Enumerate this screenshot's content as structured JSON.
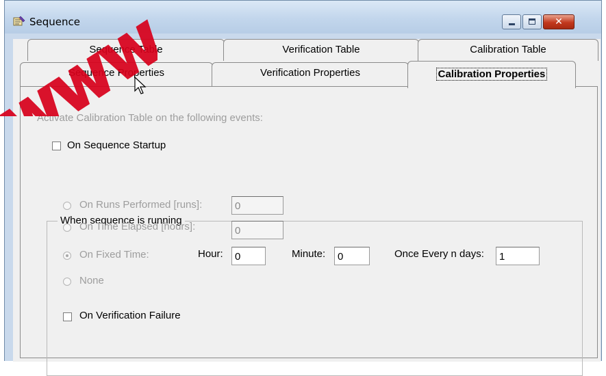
{
  "window": {
    "title": "Sequence",
    "controls": {
      "minimize": "minimize-icon",
      "maximize": "maximize-icon",
      "close": "✕"
    }
  },
  "tabs": {
    "row_back": [
      "Sequence Table",
      "Verification Table",
      "Calibration Table"
    ],
    "row_front": [
      "Sequence Properties",
      "Verification Properties",
      "Calibration Properties"
    ],
    "active": "Calibration Properties"
  },
  "panel": {
    "heading": "Activate Calibration Table on the following events:",
    "on_sequence_startup": {
      "label": "On Sequence Startup",
      "checked": false
    },
    "group_title": "When sequence is running",
    "options": [
      {
        "label": "On Runs Performed [runs]:",
        "value": "0",
        "selected": false
      },
      {
        "label": "On Time Elapsed [hours]:",
        "value": "0",
        "selected": false
      },
      {
        "label": "On Fixed Time:",
        "selected": true
      },
      {
        "label": "None",
        "selected": false
      }
    ],
    "fixed_time": {
      "hour_label": "Hour:",
      "hour_value": "0",
      "minute_label": "Minute:",
      "minute_value": "0",
      "days_label": "Once Every n days:",
      "days_value": "1"
    },
    "on_verification_failure": {
      "label": "On Verification Failure",
      "checked": false
    }
  },
  "colors": {
    "title_bar": "#c2d6ec",
    "dialog_bg": "#f0f0f0",
    "disabled_text": "#9d9d9d",
    "watermark": "#d8001b"
  }
}
